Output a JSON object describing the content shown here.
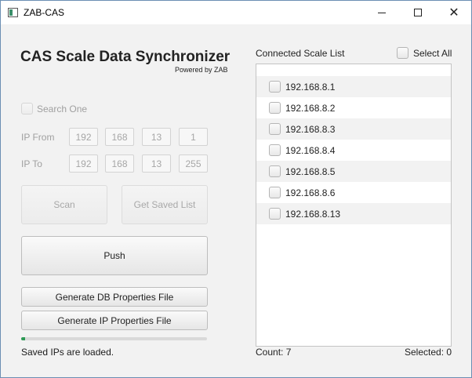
{
  "window": {
    "title": "ZAB-CAS"
  },
  "header": {
    "title": "CAS Scale Data Synchronizer",
    "subtitle": "Powered by ZAB"
  },
  "search": {
    "search_one_label": "Search One",
    "search_one_checked": false
  },
  "ip_from": {
    "label": "IP From",
    "octets": [
      "192",
      "168",
      "13",
      "1"
    ]
  },
  "ip_to": {
    "label": "IP To",
    "octets": [
      "192",
      "168",
      "13",
      "255"
    ]
  },
  "buttons": {
    "scan": "Scan",
    "get_saved_list": "Get Saved List",
    "push": "Push",
    "generate_db": "Generate DB Properties File",
    "generate_ip": "Generate IP Properties File"
  },
  "progress": {
    "value": 0.02,
    "color": "#2e9a55"
  },
  "status": "Saved IPs are loaded.",
  "scale_list": {
    "header": "Connected Scale List",
    "select_all_label": "Select All",
    "items": [
      "192.168.8.1",
      "192.168.8.2",
      "192.168.8.3",
      "192.168.8.4",
      "192.168.8.5",
      "192.168.8.6",
      "192.168.8.13"
    ]
  },
  "footer": {
    "count_label": "Count:",
    "count": "7",
    "selected_label": "Selected:",
    "selected": "0"
  }
}
